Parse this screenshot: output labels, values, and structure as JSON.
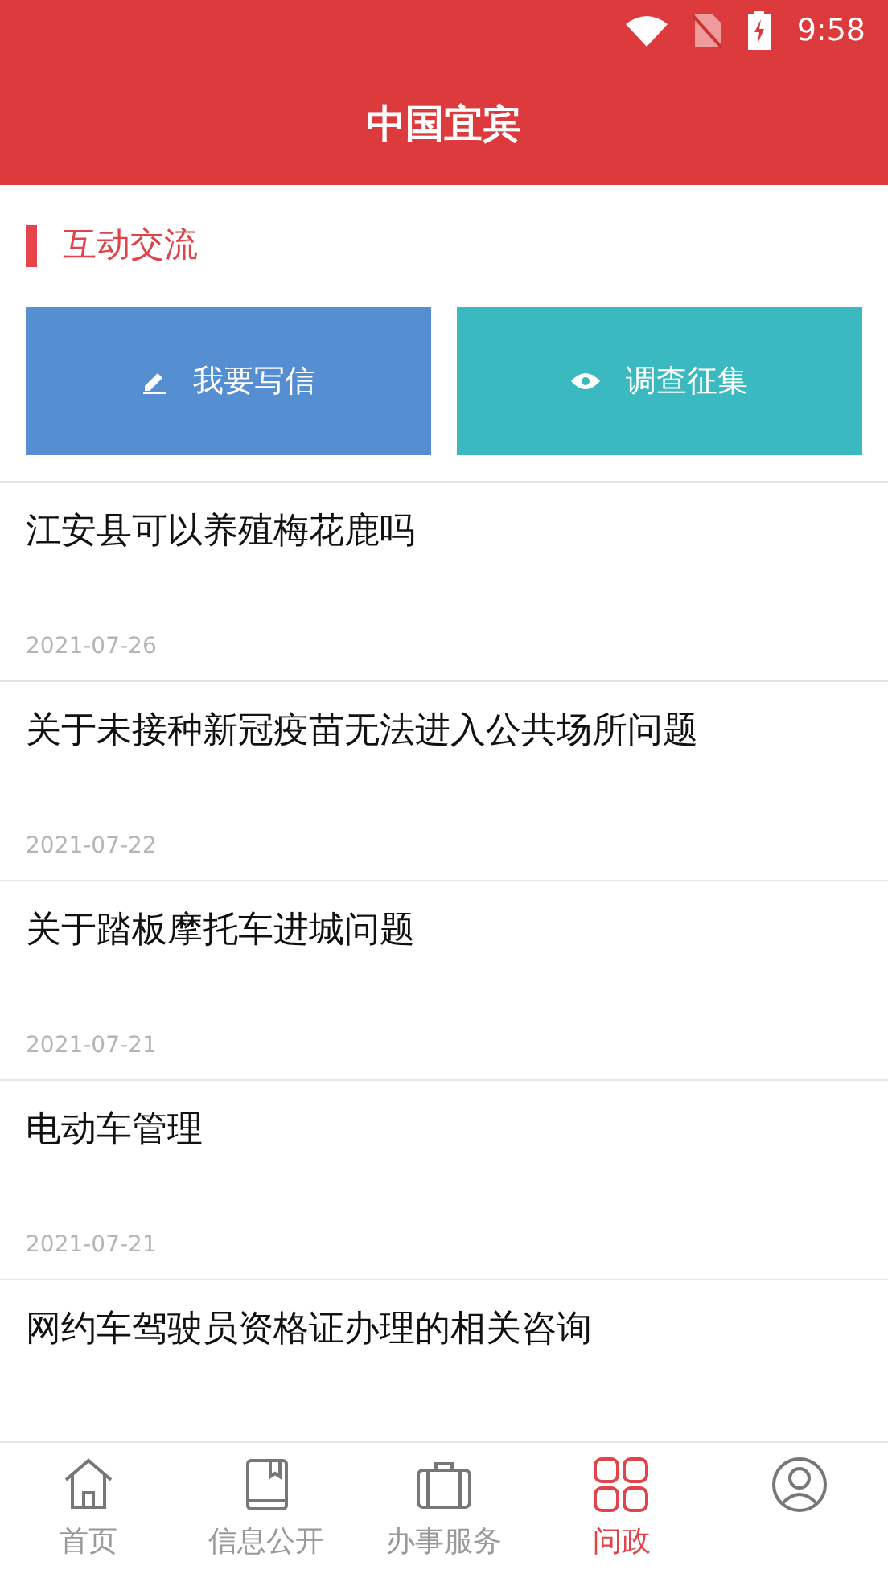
{
  "status_bar": {
    "time": "9:58"
  },
  "header": {
    "title": "中国宜宾"
  },
  "section": {
    "title": "互动交流"
  },
  "actions": [
    {
      "kind": "write",
      "label": "我要写信",
      "color": "#568ed2"
    },
    {
      "kind": "survey",
      "label": "调查征集",
      "color": "#3bb9c0"
    }
  ],
  "posts": [
    {
      "title": "江安县可以养殖梅花鹿吗",
      "date": "2021-07-26"
    },
    {
      "title": "关于未接种新冠疫苗无法进入公共场所问题",
      "date": "2021-07-22"
    },
    {
      "title": "关于踏板摩托车进城问题",
      "date": "2021-07-21"
    },
    {
      "title": "电动车管理",
      "date": "2021-07-21"
    },
    {
      "title": "网约车驾驶员资格证办理的相关咨询"
    }
  ],
  "tabs": [
    {
      "kind": "home",
      "label": "首页",
      "selected": false
    },
    {
      "kind": "book",
      "label": "信息公开",
      "selected": false
    },
    {
      "kind": "case",
      "label": "办事服务",
      "selected": false
    },
    {
      "kind": "grid",
      "label": "问政",
      "selected": true
    },
    {
      "kind": "user",
      "selected": false
    }
  ]
}
